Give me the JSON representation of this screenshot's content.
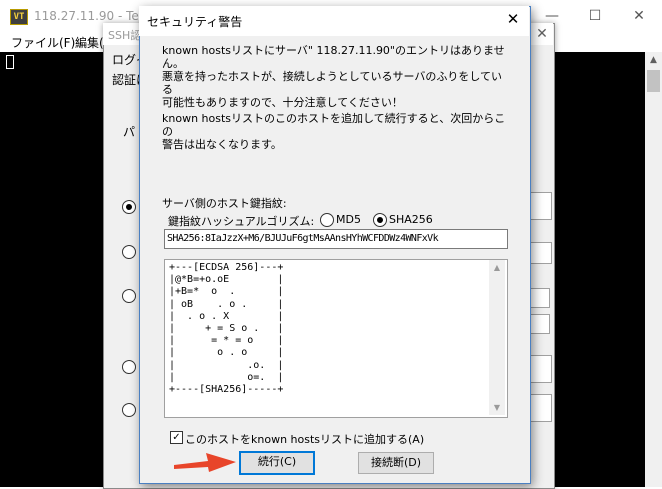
{
  "teraterm": {
    "icon_text": "VT",
    "title": "118.27.11.90 - Tera",
    "menu": [
      "ファイル(F)",
      "編集("
    ],
    "controls": [
      "—",
      "☐",
      "✕"
    ]
  },
  "ssh_auth": {
    "title": "SSH認",
    "login_label": "ログイ",
    "auth_label": "認証に",
    "pass_label": "パ",
    "close": "✕"
  },
  "dialog": {
    "title": "セキュリティ警告",
    "close": "✕",
    "message1": "known hostsリストにサーバ\" 118.27.11.90\"のエントリはありません。\n悪意を持ったホストが、接続しようとしているサーバのふりをしている\n可能性もありますので、十分注意してください！",
    "message2": "known hostsリストのこのホストを追加して続行すると、次回からこの\n警告は出なくなります。",
    "fingerprint_label": "サーバ側のホスト鍵指紋:",
    "hash_algorithm_label": "鍵指紋ハッシュアルゴリズム:",
    "hash_options": [
      "MD5",
      "SHA256"
    ],
    "hash_selected": "SHA256",
    "fingerprint_value": "SHA256:8IaJzzX+M6/BJUJuF6gtMsAAnsHYhWCFDDWz4WNFxVk",
    "randomart": "+---[ECDSA 256]---+\n|@*B=+o.oE        |\n|+B=*  o  .       |\n| oB    . o .     |\n|  . o . X        |\n|     + = S o .   |\n|      = * = o    |\n|       o . o     |\n|            .o.  |\n|            o=.  |\n+----[SHA256]-----+",
    "add_checkbox_label": "このホストをknown hostsリストに追加する(A)",
    "add_checked": true,
    "continue_button": "続行(C)",
    "disconnect_button": "接続断(D)"
  },
  "annotation": {
    "arrow_color": "#e8452a"
  }
}
